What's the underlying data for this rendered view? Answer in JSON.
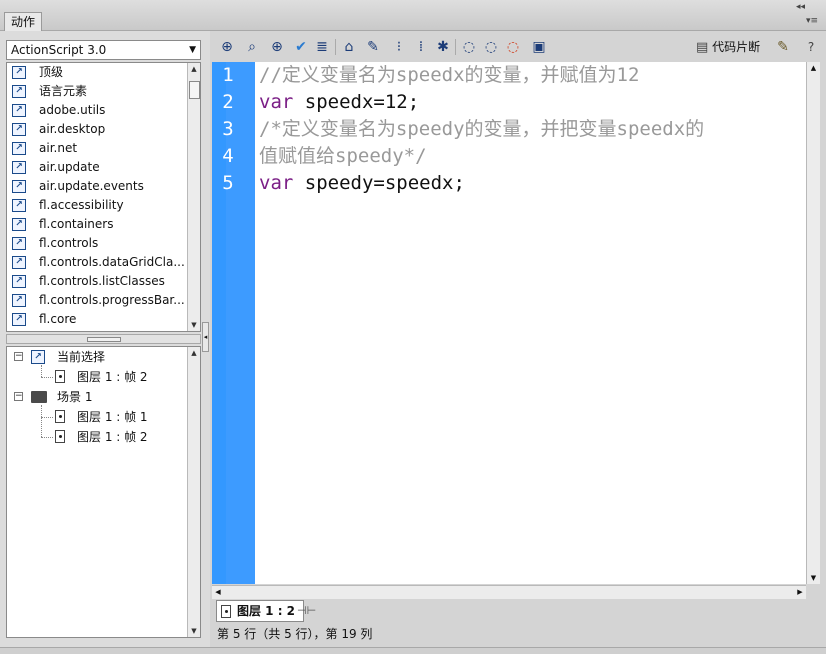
{
  "panel": {
    "tab_label": "动作",
    "collapse_glyph": "◂◂",
    "menu_glyph": "▾≡"
  },
  "language_dropdown": {
    "value": "ActionScript 3.0"
  },
  "library_items": [
    {
      "label": "顶级"
    },
    {
      "label": "语言元素"
    },
    {
      "label": "adobe.utils"
    },
    {
      "label": "air.desktop"
    },
    {
      "label": "air.net"
    },
    {
      "label": "air.update"
    },
    {
      "label": "air.update.events"
    },
    {
      "label": "fl.accessibility"
    },
    {
      "label": "fl.containers"
    },
    {
      "label": "fl.controls"
    },
    {
      "label": "fl.controls.dataGridCla..."
    },
    {
      "label": "fl.controls.listClasses"
    },
    {
      "label": "fl.controls.progressBar..."
    },
    {
      "label": "fl.core"
    }
  ],
  "tree": {
    "current_selection": "当前选择",
    "current_frame": "图层 1 : 帧 2",
    "scene": "场景 1",
    "scene_frames": [
      "图层 1 : 帧 1",
      "图层 1 : 帧 2"
    ]
  },
  "toolbar": {
    "icons": [
      "add-statement-icon",
      "find-icon",
      "target-icon",
      "check-syntax-icon",
      "auto-format-icon",
      "code-hint-icon",
      "debug-options-icon",
      "collapse-braces-icon",
      "collapse-selection-icon",
      "expand-all-icon",
      "apply-block-comment-icon",
      "apply-line-comment-icon",
      "remove-comment-icon",
      "show-hide-toolbox-icon"
    ],
    "code_snippets_label": "代码片断"
  },
  "code": {
    "lines": [
      {
        "n": "1",
        "type": "comment",
        "text": "//定义变量名为speedx的变量，并赋值为12"
      },
      {
        "n": "2",
        "type": "stmt",
        "kw": "var",
        "text": " speedx=12;"
      },
      {
        "n": "3",
        "type": "comment",
        "text": "/*定义变量名为speedy的变量，并把变量speedx的"
      },
      {
        "n": "4",
        "type": "comment",
        "text": "值赋值给speedy*/"
      },
      {
        "n": "5",
        "type": "stmt",
        "kw": "var",
        "text": " speedy=speedx;"
      }
    ]
  },
  "frame_tab": {
    "label": "图层 1 : 2"
  },
  "status": {
    "text": "第 5 行（共 5 行），第 19 列"
  },
  "colors": {
    "gutter": "#3398ff",
    "comment": "#999999",
    "keyword": "#7b1f86"
  }
}
